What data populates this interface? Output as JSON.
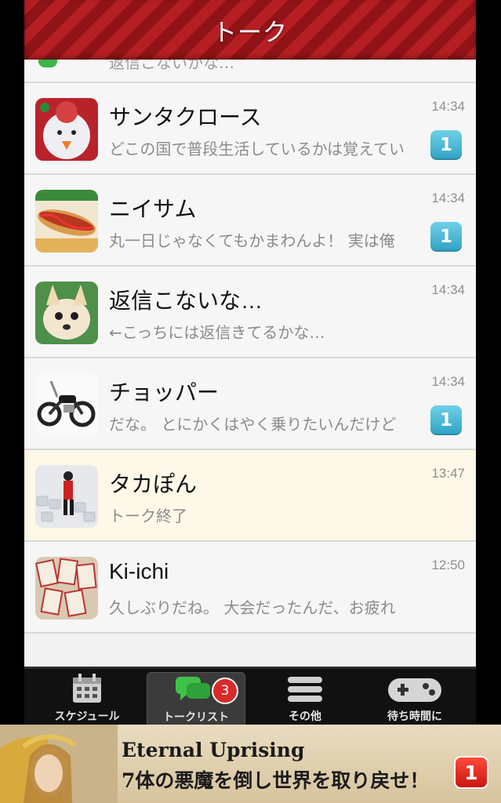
{
  "header": {
    "title": "トーク"
  },
  "partial_row": {
    "text": "返信こないかな…"
  },
  "conversations": [
    {
      "name": "サンタクロース",
      "message": "どこの国で普段生活しているかは覚えてい",
      "time": "14:34",
      "badge": "1",
      "avatar": "snowman-avatar"
    },
    {
      "name": "ニイサム",
      "message": "丸一日じゃなくてもかまわんよ！ 実は俺",
      "time": "14:34",
      "badge": "1",
      "avatar": "hotdog-avatar"
    },
    {
      "name": "返信こないな…",
      "message": "←こっちには返信きてるかな…",
      "time": "14:34",
      "badge": "",
      "avatar": "chihuahua-avatar"
    },
    {
      "name": "チョッパー",
      "message": "だな。 とにかくはやく乗りたいんだけど",
      "time": "14:34",
      "badge": "1",
      "avatar": "motorcycle-avatar"
    },
    {
      "name": "タカぽん",
      "message": "トーク終了",
      "time": "13:47",
      "badge": "",
      "avatar": "figure-avatar"
    },
    {
      "name": "Ki-ichi",
      "message": "久しぶりだね。 大会だったんだ、お疲れ",
      "time": "12:50",
      "badge": "",
      "avatar": "cards-avatar"
    }
  ],
  "tabs": [
    {
      "label": "スケジュール",
      "icon": "calendar-icon"
    },
    {
      "label": "トークリスト",
      "icon": "chat-bubble-icon",
      "badge": "3"
    },
    {
      "label": "その他",
      "icon": "menu-icon"
    },
    {
      "label": "待ち時間に",
      "icon": "gamepad-icon"
    }
  ],
  "ad": {
    "title": "Eternal Uprising",
    "subtitle": "7体の悪魔を倒し世界を取り戻せ！",
    "badge": "1"
  },
  "colors": {
    "header": "#b51f23",
    "badge": "#3aaed0",
    "highlight_row": "#fdf8e7"
  }
}
